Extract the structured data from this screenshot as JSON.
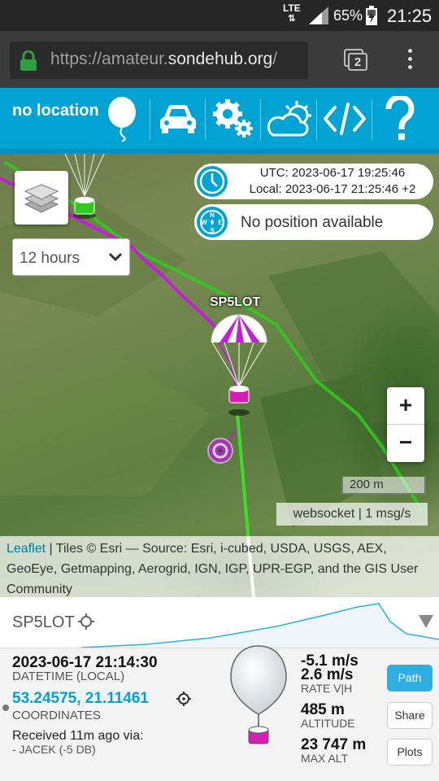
{
  "status_bar": {
    "network": "LTE",
    "battery": "65%",
    "time": "21:25"
  },
  "browser": {
    "url_prefix": "https://amateur.",
    "url_domain": "sondehub.org",
    "url_suffix": "/",
    "tab_count": "2"
  },
  "toolbar": {
    "location_label": "no location",
    "tools": [
      "balloon-icon",
      "car-icon",
      "settings-icon",
      "weather-icon",
      "embed-code-icon",
      "help-icon"
    ]
  },
  "map": {
    "time_panel": {
      "utc": "UTC: 2023-06-17 19:25:46",
      "local": "Local: 2023-06-17 21:25:46 +2"
    },
    "position_panel": {
      "text": "No position available"
    },
    "hours_select": {
      "value": "12 hours"
    },
    "payload_label": "SP5LOT",
    "zoom_in": "+",
    "zoom_out": "−",
    "scale": "200 m",
    "websocket_status": "websocket | 1 msg/s",
    "attribution": {
      "leaflet": "Leaflet",
      "text": " | Tiles © Esri — Source: Esri, i-cubed, USDA, USGS, AEX, GeoEye, Getmapping, Aerogrid, IGN, IGP, UPR-EGP, and the GIS User Community"
    },
    "colors": {
      "path_magenta": "#c21fd6",
      "predict_green": "#2ecc1e"
    }
  },
  "info": {
    "callsign": "SP5LOT",
    "datetime_value": "2023-06-17 21:14:30",
    "datetime_label": "DATETIME (LOCAL)",
    "coordinates_value": "53.24575, 21.11461",
    "coordinates_label": "COORDINATES",
    "received_value": "Received 11m ago via:",
    "received_sub": "- JACEK (-5 DB)",
    "rate_v": "-5.1 m/s",
    "rate_h": "2.6 m/s",
    "rate_label": "RATE V|H",
    "altitude_value": "485 m",
    "altitude_label": "ALTITUDE",
    "max_alt_value": "23 747 m",
    "max_alt_label": "MAX ALT",
    "buttons": {
      "path": "Path",
      "share": "Share",
      "plots": "Plots"
    },
    "accent_color": "#00a3d3"
  }
}
